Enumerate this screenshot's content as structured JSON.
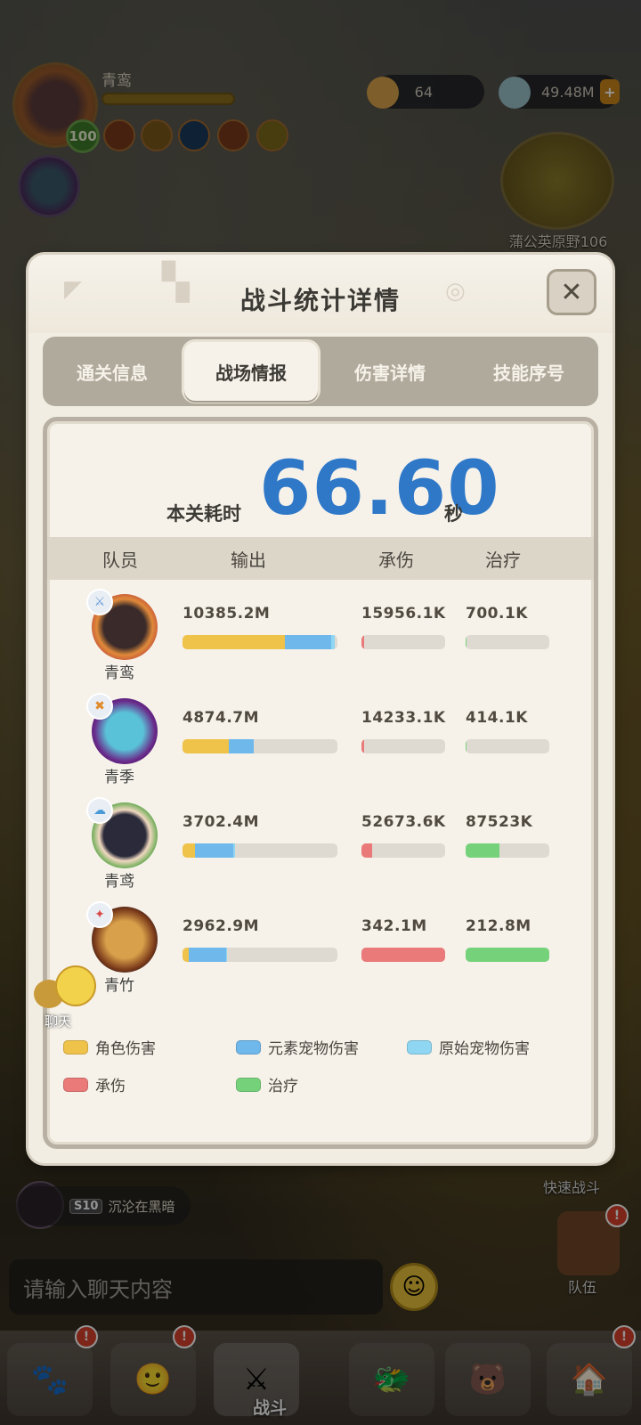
{
  "hud": {
    "player_name": "青鸾",
    "level": "100",
    "resource1": "64",
    "resource2": "49.48M",
    "map_label": "蒲公英原野106"
  },
  "modal": {
    "title": "战斗统计详情",
    "close_icon": "close-icon",
    "tabs": [
      {
        "label": "通关信息",
        "active": false
      },
      {
        "label": "战场情报",
        "active": true
      },
      {
        "label": "伤害详情",
        "active": false
      },
      {
        "label": "技能序号",
        "active": false
      }
    ],
    "time_label": "本关耗时",
    "time_value": "66.60",
    "time_unit": "秒",
    "columns": {
      "member": "队员",
      "output": "输出",
      "tank": "承伤",
      "heal": "治疗"
    },
    "rows": [
      {
        "name": "青鸾",
        "output": "10385.2M",
        "tank": "15956.1K",
        "heal": "700.1K",
        "output_char": 0.66,
        "output_elem": 0.3,
        "output_orig": 0.02,
        "tank_frac": 0.03,
        "heal_frac": 0.01
      },
      {
        "name": "青季",
        "output": "4874.7M",
        "tank": "14233.1K",
        "heal": "414.1K",
        "output_char": 0.3,
        "output_elem": 0.16,
        "output_orig": 0.0,
        "tank_frac": 0.03,
        "heal_frac": 0.0
      },
      {
        "name": "青鸢",
        "output": "3702.4M",
        "tank": "52673.6K",
        "heal": "87523K",
        "output_char": 0.08,
        "output_elem": 0.25,
        "output_orig": 0.01,
        "tank_frac": 0.13,
        "heal_frac": 0.4
      },
      {
        "name": "青竹",
        "output": "2962.9M",
        "tank": "342.1M",
        "heal": "212.8M",
        "output_char": 0.04,
        "output_elem": 0.24,
        "output_orig": 0.01,
        "tank_frac": 1.0,
        "heal_frac": 1.0
      }
    ],
    "legend": {
      "char_damage": "角色伤害",
      "elem_pet_damage": "元素宠物伤害",
      "orig_pet_damage": "原始宠物伤害",
      "tank": "承伤",
      "heal": "治疗"
    },
    "colors": {
      "char": "#efc24a",
      "elem": "#6fb8ec",
      "orig": "#8fd6f2",
      "tank": "#ea7a7a",
      "heal": "#76d27a",
      "time": "#2f78c8"
    }
  },
  "bottom": {
    "chat_label": "聊天",
    "season_tag": "S10",
    "season_name": "沉沦在黑暗",
    "fast_battle": "快速战斗",
    "team": "队伍",
    "chat_placeholder": "请输入聊天内容",
    "nav_battle": "战斗"
  }
}
